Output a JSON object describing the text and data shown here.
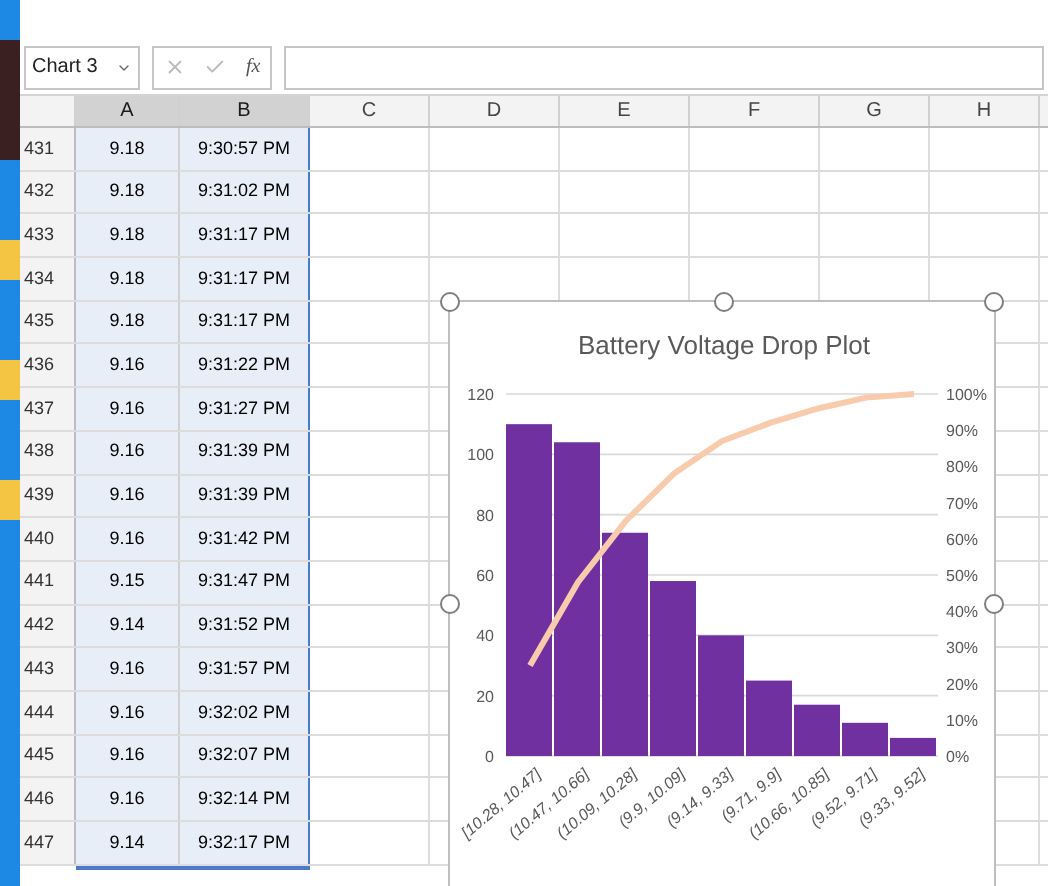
{
  "name_box": "Chart 3",
  "formula_bar": {
    "function_label": "fx"
  },
  "columns": [
    {
      "label": "A",
      "selected": true
    },
    {
      "label": "B",
      "selected": true
    },
    {
      "label": "C",
      "selected": false
    },
    {
      "label": "D",
      "selected": false
    },
    {
      "label": "E",
      "selected": false
    },
    {
      "label": "F",
      "selected": false
    },
    {
      "label": "G",
      "selected": false
    },
    {
      "label": "H",
      "selected": false
    }
  ],
  "rows": [
    {
      "number": "431",
      "a": "9.18",
      "b": "9:30:57 PM"
    },
    {
      "number": "432",
      "a": "9.18",
      "b": "9:31:02 PM"
    },
    {
      "number": "433",
      "a": "9.18",
      "b": "9:31:17 PM"
    },
    {
      "number": "434",
      "a": "9.18",
      "b": "9:31:17 PM"
    },
    {
      "number": "435",
      "a": "9.18",
      "b": "9:31:17 PM"
    },
    {
      "number": "436",
      "a": "9.16",
      "b": "9:31:22 PM"
    },
    {
      "number": "437",
      "a": "9.16",
      "b": "9:31:27 PM"
    },
    {
      "number": "438",
      "a": "9.16",
      "b": "9:31:39 PM"
    },
    {
      "number": "439",
      "a": "9.16",
      "b": "9:31:39 PM"
    },
    {
      "number": "440",
      "a": "9.16",
      "b": "9:31:42 PM"
    },
    {
      "number": "441",
      "a": "9.15",
      "b": "9:31:47 PM"
    },
    {
      "number": "442",
      "a": "9.14",
      "b": "9:31:52 PM"
    },
    {
      "number": "443",
      "a": "9.16",
      "b": "9:31:57 PM"
    },
    {
      "number": "444",
      "a": "9.16",
      "b": "9:32:02 PM"
    },
    {
      "number": "445",
      "a": "9.16",
      "b": "9:32:07 PM"
    },
    {
      "number": "446",
      "a": "9.16",
      "b": "9:32:14 PM"
    },
    {
      "number": "447",
      "a": "9.14",
      "b": "9:32:17 PM"
    }
  ],
  "chart": {
    "chart_data": {
      "type": "bar",
      "title": "Battery Voltage Drop Plot",
      "categories": [
        "[10.28, 10.47]",
        "(10.47, 10.66]",
        "(10.09, 10.28]",
        "(9.9, 10.09]",
        "(9.14, 9.33]",
        "(9.71, 9.9]",
        "(10.66, 10.85]",
        "(9.52, 9.71]",
        "(9.33, 9.52]"
      ],
      "ylim": [
        0,
        120
      ],
      "y2lim": [
        0,
        1
      ],
      "grid": true,
      "yticks": [
        0,
        20,
        40,
        60,
        80,
        100,
        120
      ],
      "y2ticks": [
        {
          "value": 0,
          "label": "0%"
        },
        {
          "value": 0.1,
          "label": "10%"
        },
        {
          "value": 0.2,
          "label": "20%"
        },
        {
          "value": 0.3,
          "label": "30%"
        },
        {
          "value": 0.4,
          "label": "40%"
        },
        {
          "value": 0.5,
          "label": "50%"
        },
        {
          "value": 0.6,
          "label": "60%"
        },
        {
          "value": 0.7,
          "label": "70%"
        },
        {
          "value": 0.8,
          "label": "80%"
        },
        {
          "value": 0.9,
          "label": "90%"
        },
        {
          "value": 1,
          "label": "100%"
        }
      ],
      "series": [
        {
          "color": "#7030a0",
          "values": [
            110,
            104,
            74,
            58,
            40,
            25,
            17,
            11,
            6
          ]
        },
        {
          "type": "line",
          "axis": "y2",
          "color": "#f8cbad",
          "values": [
            0.25,
            0.48,
            0.65,
            0.78,
            0.87,
            0.92,
            0.96,
            0.99,
            1.0
          ]
        }
      ]
    }
  }
}
